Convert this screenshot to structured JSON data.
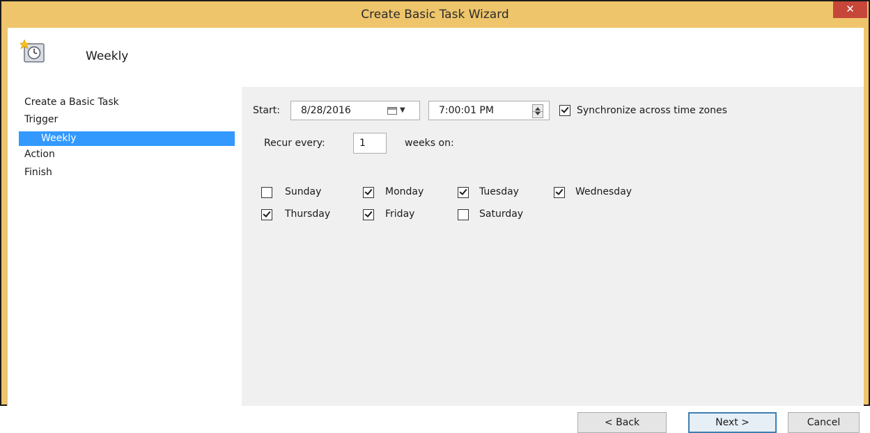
{
  "window": {
    "title": "Create Basic Task Wizard",
    "close_glyph": "✕"
  },
  "header": {
    "title": "Weekly",
    "icon": "scheduled-task-clock-icon"
  },
  "sidebar": {
    "items": [
      {
        "label": "Create a Basic Task",
        "selected": false
      },
      {
        "label": "Trigger",
        "selected": false
      },
      {
        "label": "Weekly",
        "selected": true
      },
      {
        "label": "Action",
        "selected": false
      },
      {
        "label": "Finish",
        "selected": false
      }
    ]
  },
  "trigger": {
    "start_label": "Start:",
    "start_date": "8/28/2016",
    "start_time": "7:00:01 PM",
    "sync_label": "Synchronize across time zones",
    "sync_checked": true,
    "recur_label": "Recur every:",
    "recur_value": "1",
    "weeks_on_label": "weeks on:",
    "days": [
      {
        "label": "Sunday",
        "checked": false
      },
      {
        "label": "Monday",
        "checked": true
      },
      {
        "label": "Tuesday",
        "checked": true
      },
      {
        "label": "Wednesday",
        "checked": true
      },
      {
        "label": "Thursday",
        "checked": true
      },
      {
        "label": "Friday",
        "checked": true
      },
      {
        "label": "Saturday",
        "checked": false
      }
    ]
  },
  "buttons": {
    "back": "< Back",
    "next": "Next >",
    "cancel": "Cancel"
  },
  "colors": {
    "titlebar": "#efc56b",
    "close": "#c7463a",
    "selection": "#3399ff",
    "content_bg": "#f0f0f0"
  }
}
